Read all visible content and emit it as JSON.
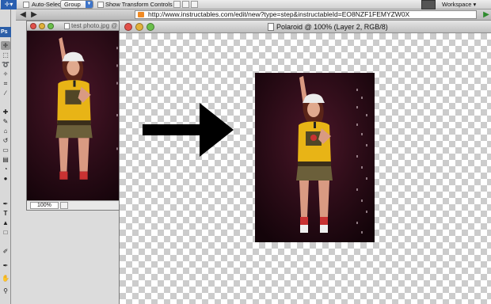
{
  "options_bar": {
    "auto_select_label": "Auto-Select:",
    "auto_select_value": "Group",
    "show_transform_label": "Show Transform Controls",
    "workspace_label": "Workspace ▾"
  },
  "browser": {
    "url": "http://www.instructables.com/edit/new?type=step&instructableId=EO8NZF1FEMYZW0X"
  },
  "doc_small": {
    "title": "test photo.jpg @",
    "zoom": "100%"
  },
  "doc_main": {
    "title": "Polaroid @ 100% (Layer 2, RGB/8)"
  },
  "tools": [
    "move-tool",
    "marquee-tool",
    "lasso-tool",
    "magic-wand-tool",
    "crop-tool",
    "slice-tool",
    "healing-tool",
    "brush-tool",
    "stamp-tool",
    "history-brush-tool",
    "eraser-tool",
    "gradient-tool",
    "blur-tool",
    "dodge-tool",
    "pen-tool",
    "type-tool",
    "path-select-tool",
    "shape-tool",
    "notes-tool",
    "eyedropper-tool",
    "hand-tool",
    "zoom-tool"
  ],
  "colors": {
    "canvas_bg": "#1e0710",
    "shirt": "#e8b416",
    "skin": "#d99a82",
    "shorts": "#6b5f3a",
    "arrow": "#000000"
  }
}
